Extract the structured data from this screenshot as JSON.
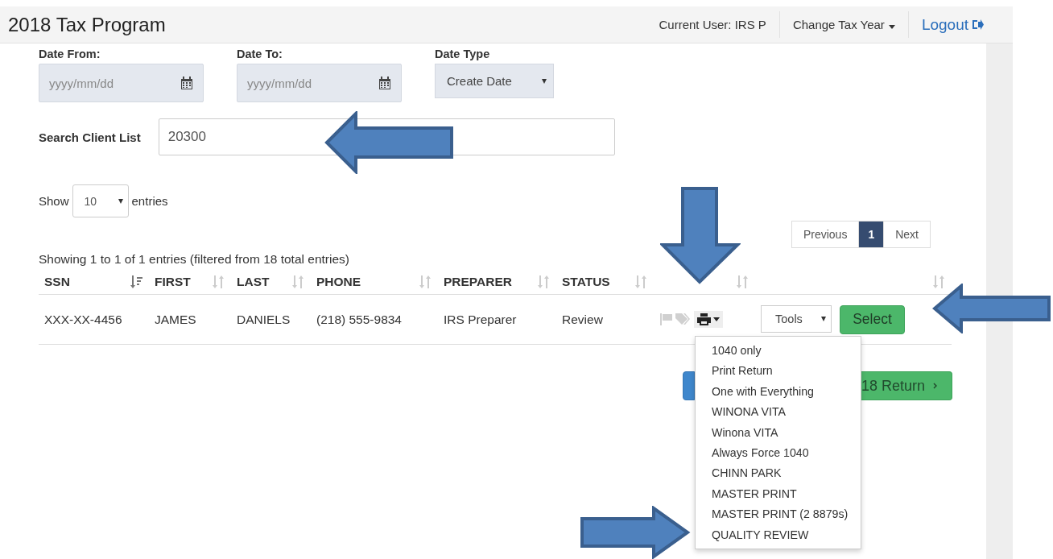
{
  "header": {
    "title": "2018 Tax Program",
    "current_user": "Current User: IRS P",
    "tax_year_menu": "Change Tax Year",
    "logout": "Logout"
  },
  "filters": {
    "date_from": {
      "label": "Date From:",
      "placeholder": "yyyy/mm/dd"
    },
    "date_to": {
      "label": "Date To:",
      "placeholder": "yyyy/mm/dd"
    },
    "date_type": {
      "label": "Date Type",
      "value": "Create Date"
    }
  },
  "search": {
    "label": "Search Client List",
    "value": "20300"
  },
  "length": {
    "before": "Show",
    "value": "10",
    "after": "entries"
  },
  "pagination": [
    {
      "label": "Previous",
      "selected": false
    },
    {
      "label": "1",
      "selected": true
    },
    {
      "label": "Next",
      "selected": false
    }
  ],
  "info": "Showing 1 to 1 of 1 entries (filtered from 18 total entries)",
  "table": {
    "columns": [
      {
        "label": "SSN",
        "sorted": true
      },
      {
        "label": "FIRST",
        "sorted": false
      },
      {
        "label": "LAST",
        "sorted": false
      },
      {
        "label": "PHONE",
        "sorted": false
      },
      {
        "label": "PREPARER",
        "sorted": false
      },
      {
        "label": "STATUS",
        "sorted": false
      },
      {
        "sorted": false
      },
      {
        "sorted": false
      }
    ],
    "rows": [
      {
        "ssn": "XXX-XX-4456",
        "first": "JAMES",
        "last": "DANIELS",
        "phone": "(218) 555-9834",
        "preparer": "IRS Preparer",
        "status": "Review",
        "tools": "Tools",
        "select": "Select",
        "print_menu_expanded": true
      }
    ]
  },
  "return_button": "18 Return",
  "print_menu": [
    {
      "label": "1040 only"
    },
    {
      "label": "Print Return"
    },
    {
      "label": "One with Everything"
    },
    {
      "label": "WINONA VITA"
    },
    {
      "label": "Winona VITA"
    },
    {
      "label": "Always Force 1040"
    },
    {
      "label": "CHINN PARK"
    },
    {
      "label": "MASTER PRINT"
    },
    {
      "label": "MASTER PRINT (2 8879s)"
    },
    {
      "label": "QUALITY REVIEW"
    }
  ],
  "annotations": [
    {
      "kind": "left"
    },
    {
      "kind": "down"
    },
    {
      "kind": "left"
    },
    {
      "kind": "right"
    }
  ]
}
